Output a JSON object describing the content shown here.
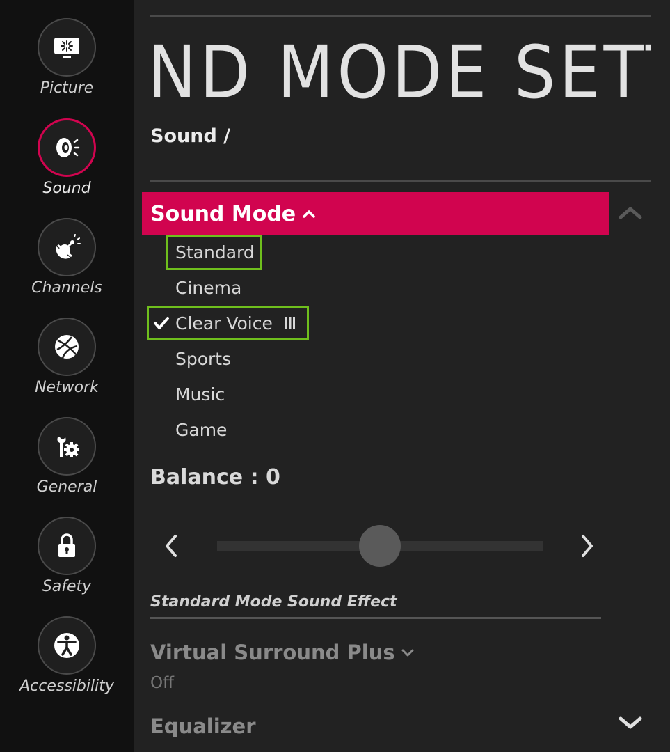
{
  "sidebar": {
    "items": [
      {
        "label": "Picture",
        "icon": "picture-icon",
        "active": false
      },
      {
        "label": "Sound",
        "icon": "sound-icon",
        "active": true
      },
      {
        "label": "Channels",
        "icon": "channels-icon",
        "active": false
      },
      {
        "label": "Network",
        "icon": "network-icon",
        "active": false
      },
      {
        "label": "General",
        "icon": "general-icon",
        "active": false
      },
      {
        "label": "Safety",
        "icon": "lock-icon",
        "active": false
      },
      {
        "label": "Accessibility",
        "icon": "accessibility-icon",
        "active": false
      }
    ]
  },
  "header": {
    "title": "ND MODE SETTINC",
    "breadcrumb": "Sound /"
  },
  "sound_mode": {
    "label": "Sound Mode",
    "options": [
      "Standard",
      "Cinema",
      "Clear Voice",
      "Sports",
      "Music",
      "Game"
    ],
    "selected": "Clear Voice",
    "focused": "Standard"
  },
  "balance": {
    "label": "Balance : 0",
    "value": 0,
    "min": -50,
    "max": 50
  },
  "effects": {
    "title": "Standard Mode Sound Effect",
    "virtual_surround_label": "Virtual Surround Plus",
    "virtual_surround_value": "Off",
    "equalizer_label": "Equalizer"
  },
  "colors": {
    "accent": "#d1044f",
    "highlight_box": "#6fbf1d",
    "sidebar_bg": "#111111",
    "main_bg": "#222222"
  }
}
